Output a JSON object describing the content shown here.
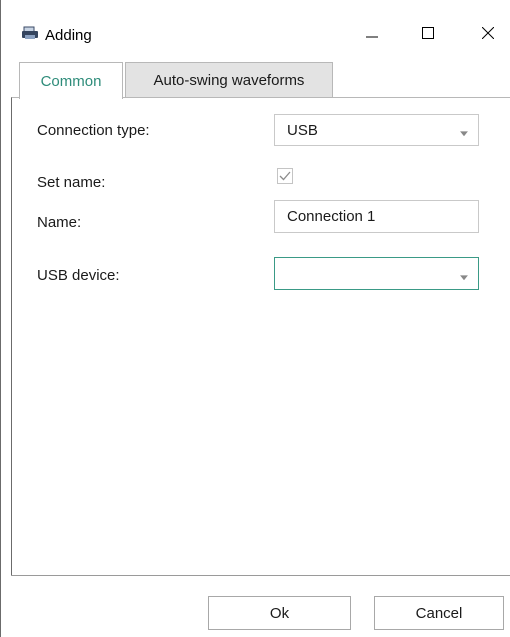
{
  "window": {
    "title": "Adding",
    "icon": "printer-icon"
  },
  "tabs": [
    {
      "label": "Common",
      "active": true
    },
    {
      "label": "Auto-swing waveforms",
      "active": false
    }
  ],
  "form": {
    "connection_type_label": "Connection type:",
    "connection_type_value": "USB",
    "set_name_label": "Set name:",
    "set_name_checked": true,
    "name_label": "Name:",
    "name_value": "Connection 1",
    "usb_device_label": "USB device:",
    "usb_device_value": ""
  },
  "buttons": {
    "ok": "Ok",
    "cancel": "Cancel"
  },
  "colors": {
    "accent": "#2e8c7a",
    "focus_border": "#3a9a86"
  }
}
